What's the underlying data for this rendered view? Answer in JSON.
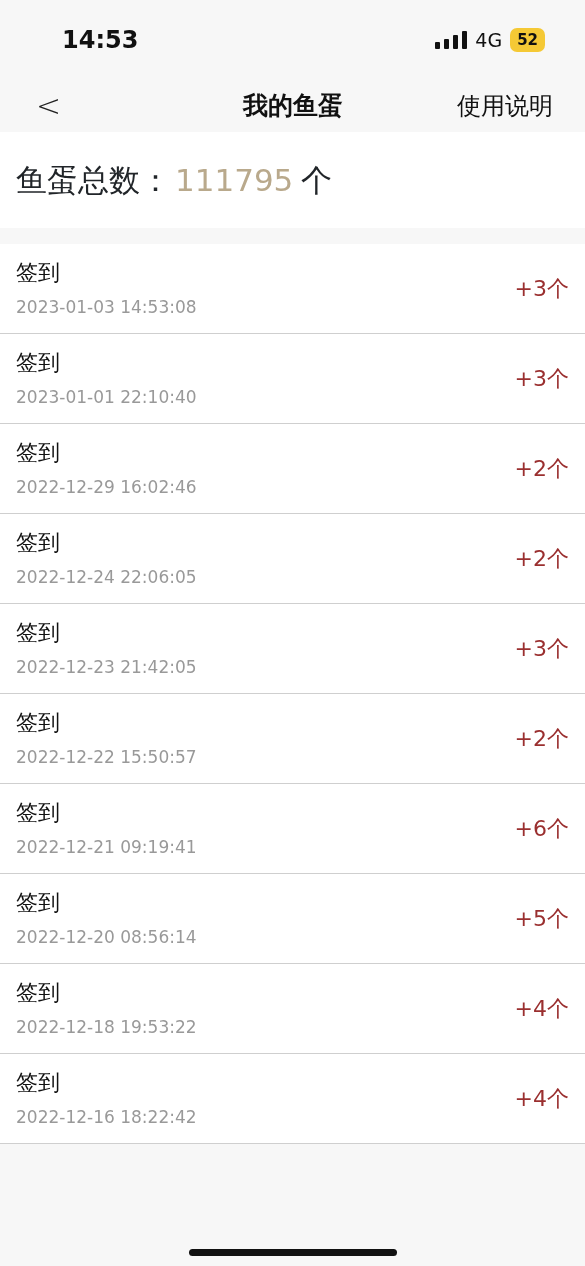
{
  "status_bar": {
    "time": "14:53",
    "network": "4G",
    "battery": "52"
  },
  "nav": {
    "back": "<",
    "title": "我的鱼蛋",
    "action": "使用说明"
  },
  "summary": {
    "label": "鱼蛋总数：",
    "total": "111795",
    "unit": "个"
  },
  "records": [
    {
      "title": "签到",
      "time": "2023-01-03 14:53:08",
      "amount": "+3个"
    },
    {
      "title": "签到",
      "time": "2023-01-01 22:10:40",
      "amount": "+3个"
    },
    {
      "title": "签到",
      "time": "2022-12-29 16:02:46",
      "amount": "+2个"
    },
    {
      "title": "签到",
      "time": "2022-12-24 22:06:05",
      "amount": "+2个"
    },
    {
      "title": "签到",
      "time": "2022-12-23 21:42:05",
      "amount": "+3个"
    },
    {
      "title": "签到",
      "time": "2022-12-22 15:50:57",
      "amount": "+2个"
    },
    {
      "title": "签到",
      "time": "2022-12-21 09:19:41",
      "amount": "+6个"
    },
    {
      "title": "签到",
      "time": "2022-12-20 08:56:14",
      "amount": "+5个"
    },
    {
      "title": "签到",
      "time": "2022-12-18 19:53:22",
      "amount": "+4个"
    },
    {
      "title": "签到",
      "time": "2022-12-16 18:22:42",
      "amount": "+4个"
    }
  ]
}
